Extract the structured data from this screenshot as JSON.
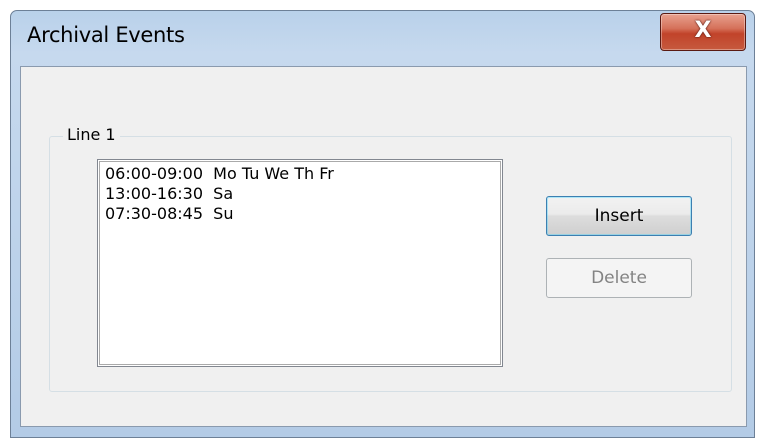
{
  "window": {
    "title": "Archival Events",
    "close_glyph": "X"
  },
  "group": {
    "label": "Line 1"
  },
  "events": [
    "06:00-09:00  Mo Tu We Th Fr",
    "13:00-16:30  Sa",
    "07:30-08:45  Su"
  ],
  "buttons": {
    "insert_label": "Insert",
    "delete_label": "Delete"
  },
  "colors": {
    "frame": "#b9d1ea",
    "close_button": "#c1432a",
    "client": "#f0f0f0"
  }
}
